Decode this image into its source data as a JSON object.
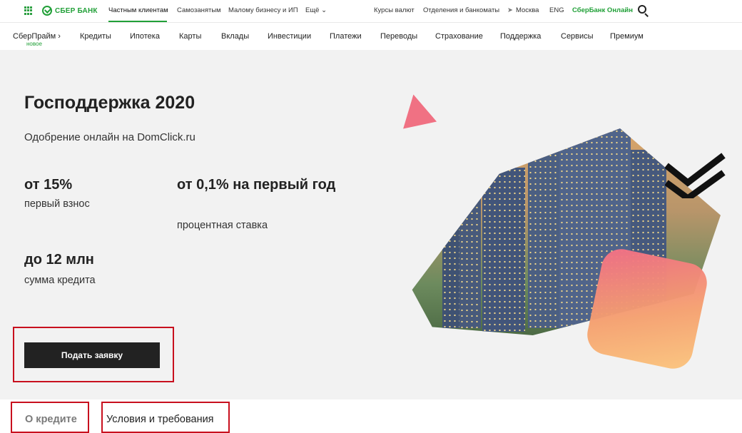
{
  "brand": {
    "name": "СБЕР БАНК",
    "color": "#21a038"
  },
  "topbar": {
    "segments": [
      "Частным клиентам",
      "Самозанятым",
      "Малому бизнесу и ИП",
      "Ещё ⌄"
    ],
    "links": [
      "Курсы валют",
      "Отделения и банкоматы",
      "Москва",
      "ENG",
      "СберБанк Онлайн"
    ],
    "location_icon": "location-arrow-icon",
    "search_icon": "search-icon"
  },
  "mainnav": {
    "items": [
      "СберПрайм ›",
      "Кредиты",
      "Ипотека",
      "Карты",
      "Вклады",
      "Инвестиции",
      "Платежи",
      "Переводы",
      "Страхование",
      "Поддержка",
      "Сервисы",
      "Премиум"
    ],
    "badge": "новое"
  },
  "hero": {
    "title": "Господдержка 2020",
    "subtitle": "Одобрение онлайн на DomClick.ru",
    "stats": [
      {
        "value": "от 15%",
        "label": "первый взнос"
      },
      {
        "value": "от 0,1% на первый год",
        "label": "процентная ставка"
      },
      {
        "value": "до 12 млн",
        "label": "сумма кредита"
      }
    ],
    "cta": "Подать заявку"
  },
  "tabs": [
    "О кредите",
    "Условия и требования"
  ],
  "colors": {
    "highlight": "#c8101e",
    "hero_bg": "#f2f2f2",
    "button": "#222222"
  }
}
